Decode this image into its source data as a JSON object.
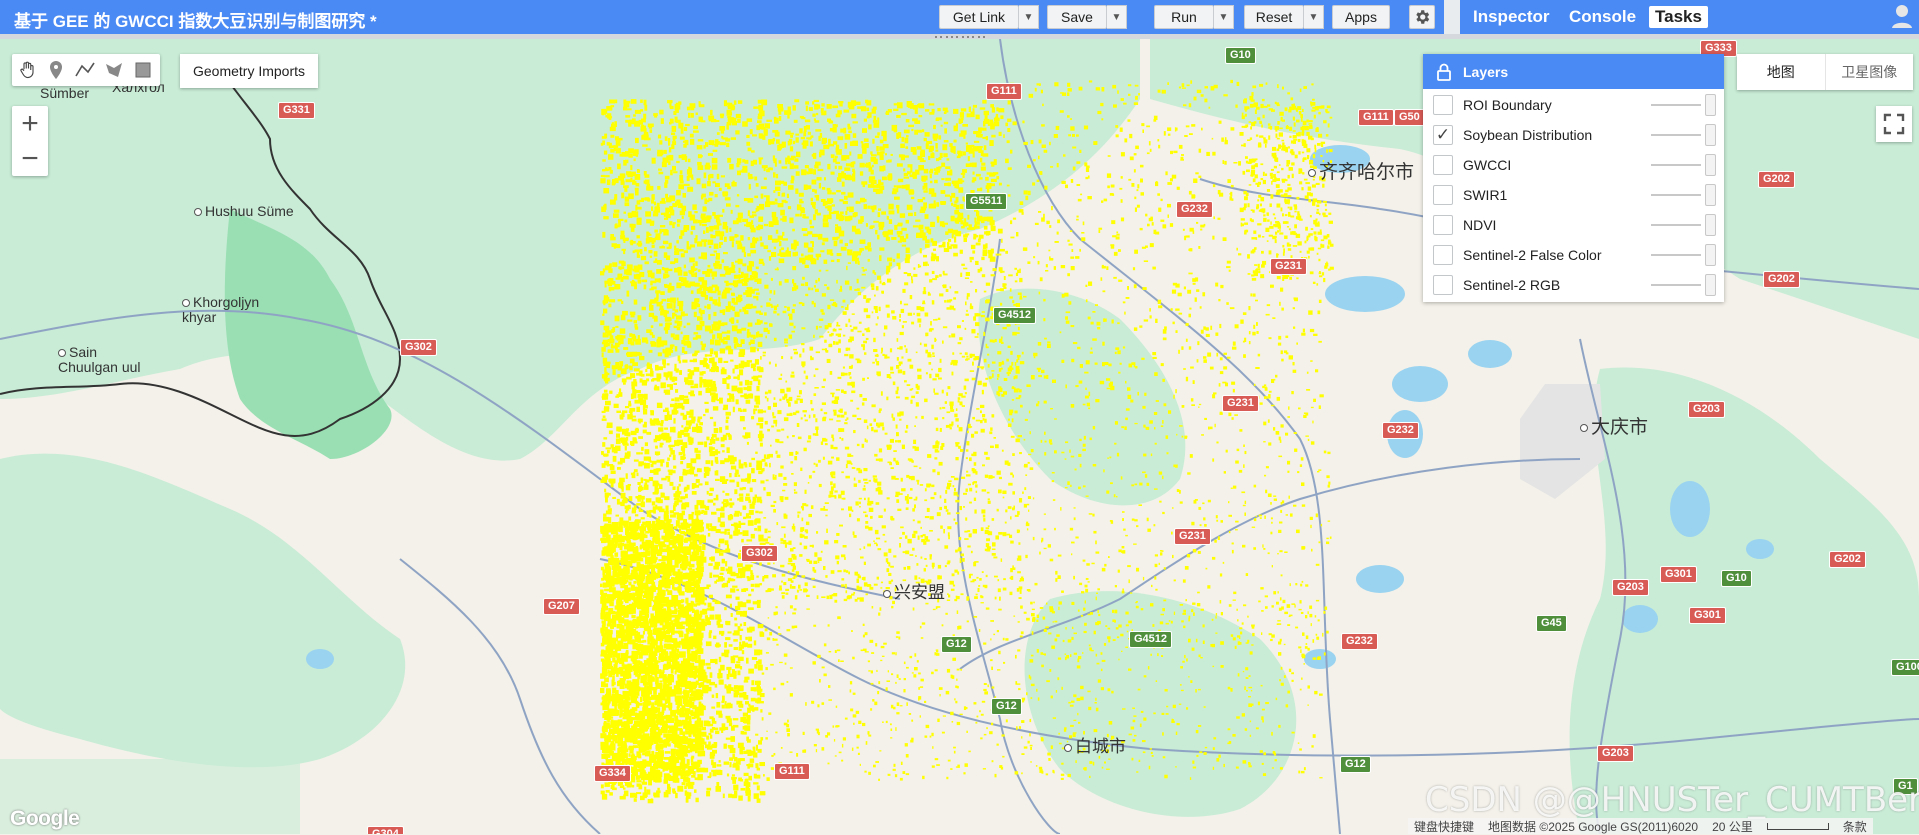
{
  "title": "基于 GEE 的 GWCCI 指数大豆识别与制图研究 *",
  "toolbar": {
    "get_link": "Get Link",
    "save": "Save",
    "run": "Run",
    "reset": "Reset",
    "apps": "Apps"
  },
  "right_tabs": [
    "Inspector",
    "Console",
    "Tasks"
  ],
  "active_tab": "Tasks",
  "drawing": {
    "geometry_imports": "Geometry Imports"
  },
  "layers": {
    "header": "Layers",
    "items": [
      {
        "name": "ROI Boundary",
        "checked": false
      },
      {
        "name": "Soybean Distribution",
        "checked": true
      },
      {
        "name": "GWCCI",
        "checked": false
      },
      {
        "name": "SWIR1",
        "checked": false
      },
      {
        "name": "NDVI",
        "checked": false
      },
      {
        "name": "Sentinel-2 False Color",
        "checked": false
      },
      {
        "name": "Sentinel-2 RGB",
        "checked": false
      }
    ]
  },
  "map_type": {
    "map": "地图",
    "satellite": "卫星图像"
  },
  "places": {
    "sumber": "Sümber",
    "khalkhgol": "Халхгол",
    "hushuu": "Hushuu Süme",
    "khorgoljyn": "Khorgoljyn\nkhyar",
    "sain": "Sain\nChuulgan uul",
    "qiqihar": "齐齐哈尔市",
    "daqing": "大庆市",
    "xinganmeng": "兴安盟",
    "baicheng": "白城市"
  },
  "shields": {
    "g331": "G331",
    "g10": "G10",
    "g333": "G333",
    "g111a": "G111",
    "g111b": "G111",
    "g111c": "G111",
    "g5511": "G5511",
    "g4512": "G4512",
    "g232": "G232",
    "g202a": "G202",
    "g202b": "G202",
    "g202c": "G202",
    "g231a": "G231",
    "g231b": "G231",
    "g231c": "G231",
    "g302a": "G302",
    "g302b": "G302",
    "g232b": "G232",
    "g203a": "G203",
    "g203b": "G203",
    "g203c": "G203",
    "g207": "G207",
    "g301a": "G301",
    "g301b": "G301",
    "g10b": "G10",
    "g45": "G45",
    "g12a": "G12",
    "g12b": "G12",
    "g12c": "G12",
    "g232c": "G232",
    "g334": "G334",
    "g304": "G304",
    "g4512b": "G4512",
    "g1": "G1",
    "g100": "G100",
    "g5511b": "G5511",
    "g50": "G50"
  },
  "attribution": {
    "shortcuts": "键盘快捷键",
    "data": "地图数据 ©2025 Google GS(2011)6020",
    "scale": "20 公里",
    "terms": "条款"
  },
  "google_logo": "Google",
  "watermark": "CSDN @@HNUSTer_CUMTBer",
  "colors": {
    "accent": "#4a8af4",
    "soybean": "#ffff00",
    "map_base": "#f3f1e9",
    "green_area": "#c8ecd6",
    "water": "#9ad3f0",
    "road_major": "#d95b56",
    "road_expressway": "#4f8f3c"
  }
}
